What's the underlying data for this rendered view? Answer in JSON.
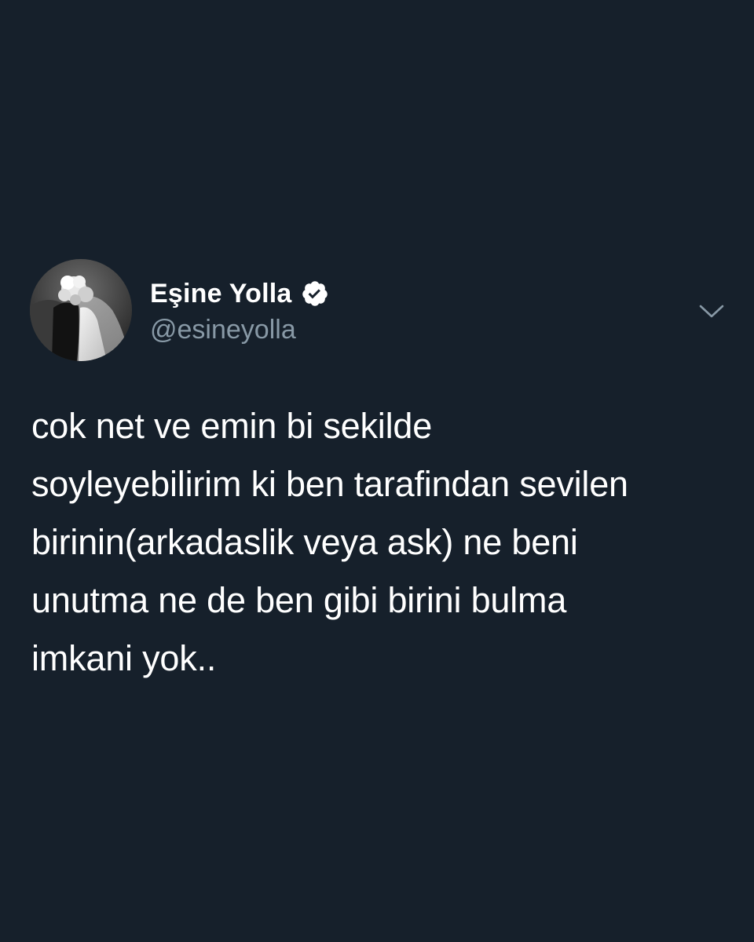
{
  "tweet": {
    "author": {
      "display_name": "Eşine Yolla",
      "handle": "@esineyolla",
      "verified": true,
      "avatar_icon": "wedding-couple-photo",
      "verified_icon": "verified-badge-icon"
    },
    "menu_icon": "chevron-down-icon",
    "text_lines": [
      "cok net ve emin bi sekilde",
      "soyleyebilirim ki ben tarafindan sevilen",
      "birinin(arkadaslik veya ask) ne beni",
      "unutma ne de ben gibi birini bulma",
      "imkani yok.."
    ]
  },
  "colors": {
    "background": "#16202b",
    "text_primary": "#ffffff",
    "text_secondary": "#8899a6"
  }
}
